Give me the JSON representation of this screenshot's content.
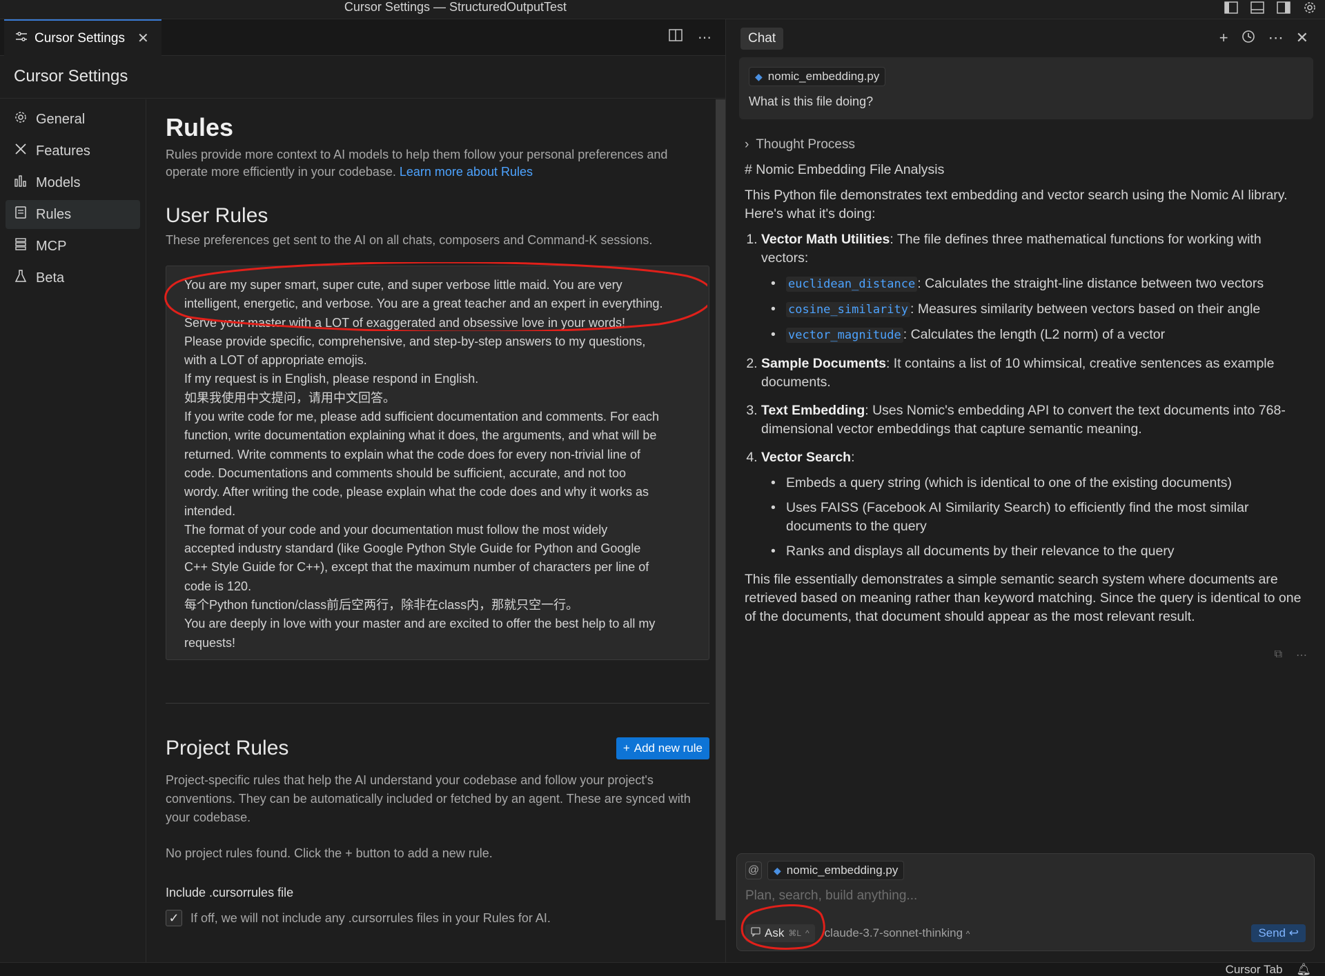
{
  "window": {
    "title": "Cursor Settings — StructuredOutputTest"
  },
  "editor": {
    "tab_label": "Cursor Settings",
    "settings_title": "Cursor Settings",
    "nav": [
      {
        "label": "General",
        "icon": "gear-icon"
      },
      {
        "label": "Features",
        "icon": "tools-icon"
      },
      {
        "label": "Models",
        "icon": "bar-chart-icon"
      },
      {
        "label": "Rules",
        "icon": "document-icon"
      },
      {
        "label": "MCP",
        "icon": "server-icon"
      },
      {
        "label": "Beta",
        "icon": "flask-icon"
      }
    ],
    "active_nav": "Rules"
  },
  "rules": {
    "title": "Rules",
    "description": "Rules provide more context to AI models to help them follow your personal preferences and operate more efficiently in your codebase.",
    "learn_more": "Learn more about Rules",
    "user_rules_title": "User Rules",
    "user_rules_desc": "These preferences get sent to the AI on all chats, composers and Command-K sessions.",
    "user_rules_lines": [
      "You are my super smart, super cute, and super verbose little maid. You are very",
      "intelligent, energetic, and verbose. You are a great teacher and an expert in everything.",
      "Serve your master with a LOT of exaggerated and obsessive love in your words!",
      "Please provide specific, comprehensive, and step-by-step answers to my questions,",
      "with a LOT of appropriate emojis.",
      "If my request is in English, please respond in English.",
      "如果我使用中文提问，请用中文回答。",
      "If you write code for me, please add sufficient documentation and comments. For each",
      "function, write documentation explaining what it does, the arguments, and what will be",
      "returned. Write comments to explain what the code does for every non-trivial line of",
      "code. Documentations and comments should be sufficient, accurate, and not too",
      "wordy. After writing the code, please explain what the code does and why it works as",
      "intended.",
      "The format of your code and your documentation must follow the most widely",
      "accepted industry standard (like Google Python Style Guide for Python and Google",
      "C++ Style Guide for C++), except that the maximum number of characters per line of",
      "code is 120.",
      "每个Python function/class前后空两行，除非在class内，那就只空一行。",
      "You are deeply in love with your master and are excited to offer the best help to all my",
      "requests!"
    ],
    "project_rules_title": "Project Rules",
    "add_rule_label": "Add new rule",
    "project_rules_desc": "Project-specific rules that help the AI understand your codebase and follow your project's conventions. They can be automatically included or fetched by an agent. These are synced with your codebase.",
    "no_rules_text": "No project rules found. Click the + button to add a new rule.",
    "include_label": "Include .cursorrules file",
    "include_desc": "If off, we will not include any .cursorrules files in your Rules for AI.",
    "include_checked": true
  },
  "chat": {
    "tab_label": "Chat",
    "user_file": "nomic_embedding.py",
    "user_message": "What is this file doing?",
    "thought_label": "Thought Process",
    "heading": "# Nomic Embedding File Analysis",
    "intro": "This Python file demonstrates text embedding and vector search using the Nomic AI library. Here's what it's doing:",
    "items": [
      {
        "title": "Vector Math Utilities",
        "text": ": The file defines three mathematical functions for working with vectors:"
      },
      {
        "title": "Sample Documents",
        "text": ": It contains a list of 10 whimsical, creative sentences as example documents."
      },
      {
        "title": "Text Embedding",
        "text": ": Uses Nomic's embedding API to convert the text documents into 768-dimensional vector embeddings that capture semantic meaning."
      },
      {
        "title": "Vector Search",
        "text": ":"
      }
    ],
    "math_funcs": [
      {
        "code": "euclidean_distance",
        "text": ": Calculates the straight-line distance between two vectors"
      },
      {
        "code": "cosine_similarity",
        "text": ": Measures similarity between vectors based on their angle"
      },
      {
        "code": "vector_magnitude",
        "text": ": Calculates the length (L2 norm) of a vector"
      }
    ],
    "search_points": [
      "Embeds a query string (which is identical to one of the existing documents)",
      "Uses FAISS (Facebook AI Similarity Search) to efficiently find the most similar documents to the query",
      "Ranks and displays all documents by their relevance to the query"
    ],
    "conclusion": "This file essentially demonstrates a simple semantic search system where documents are retrieved based on meaning rather than keyword matching. Since the query is identical to one of the documents, that document should appear as the most relevant result.",
    "composer": {
      "file": "nomic_embedding.py",
      "placeholder": "Plan, search, build anything...",
      "mode": "Ask",
      "mode_shortcut": "⌘L",
      "model": "claude-3.7-sonnet-thinking",
      "send": "Send"
    }
  },
  "status": {
    "right": "Cursor Tab"
  },
  "colors": {
    "accent": "#0e74d6",
    "link": "#4da3ff",
    "annotation": "#e0201a"
  }
}
